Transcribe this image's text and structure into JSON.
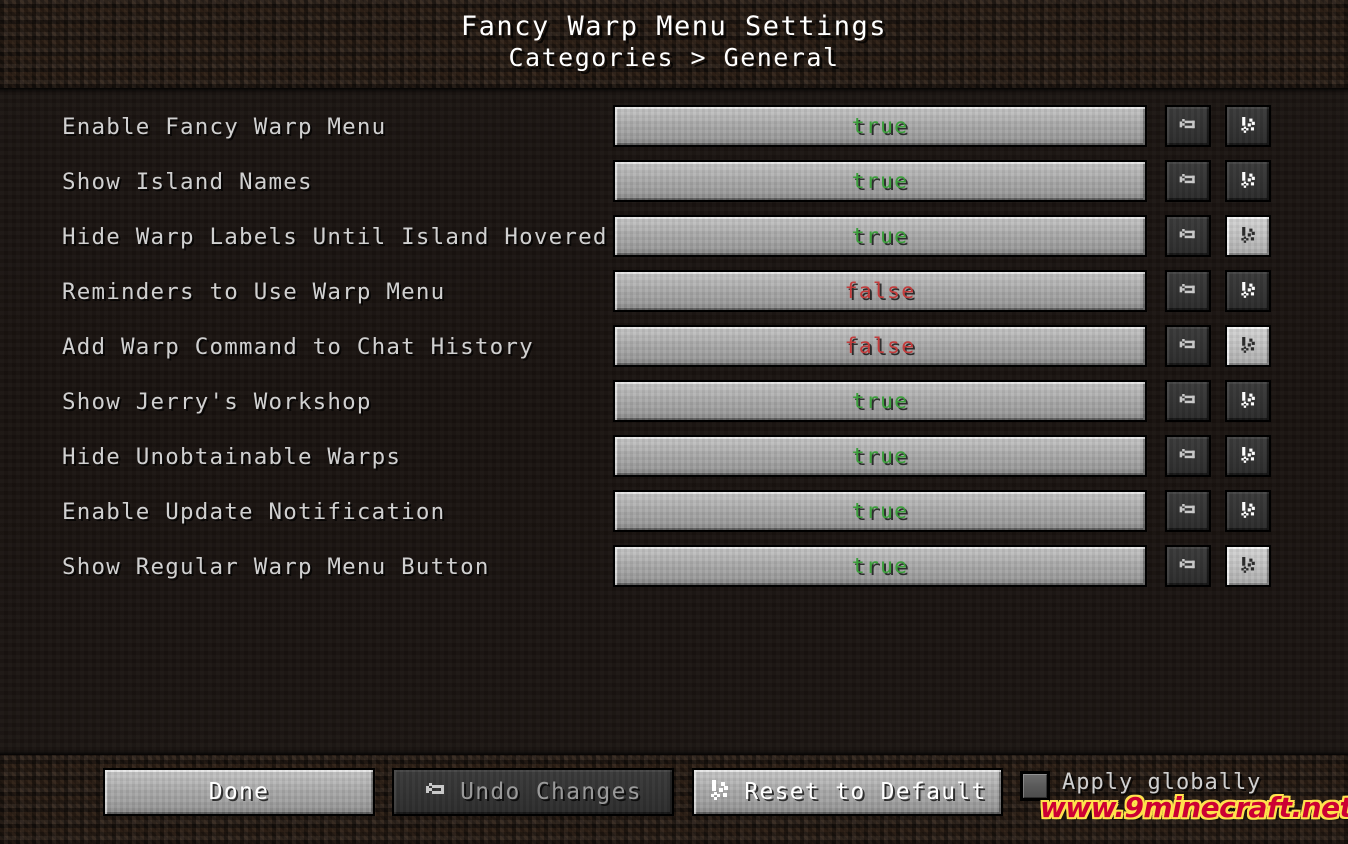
{
  "header": {
    "title": "Fancy Warp Menu Settings",
    "breadcrumb": "Categories > General"
  },
  "colors": {
    "true_value": "#3ca03c",
    "false_value": "#c43c3c",
    "label_text": "#d0d0d0",
    "button_face": "#a8a8a8",
    "dirt_background": "#4a3526",
    "watermark_fill": "#cc0033",
    "watermark_outline": "#ffe14d"
  },
  "settings": [
    {
      "label": "Enable Fancy Warp Menu",
      "value": "true",
      "undo_icon": "undo-arrow-icon",
      "reset_icon": "reset-broom-icon",
      "undo_state": "disabled",
      "reset_state": "normal"
    },
    {
      "label": "Show Island Names",
      "value": "true",
      "undo_icon": "undo-arrow-icon",
      "reset_icon": "reset-broom-icon",
      "undo_state": "disabled",
      "reset_state": "normal"
    },
    {
      "label": "Hide Warp Labels Until Island Hovered",
      "value": "true",
      "undo_icon": "undo-arrow-icon",
      "reset_icon": "reset-broom-icon",
      "undo_state": "disabled",
      "reset_state": "highlighted"
    },
    {
      "label": "Reminders to Use Warp Menu",
      "value": "false",
      "undo_icon": "undo-arrow-icon",
      "reset_icon": "reset-broom-icon",
      "undo_state": "disabled",
      "reset_state": "normal"
    },
    {
      "label": "Add Warp Command to Chat History",
      "value": "false",
      "undo_icon": "undo-arrow-icon",
      "reset_icon": "reset-broom-icon",
      "undo_state": "disabled",
      "reset_state": "highlighted"
    },
    {
      "label": "Show Jerry's Workshop",
      "value": "true",
      "undo_icon": "undo-arrow-icon",
      "reset_icon": "reset-broom-icon",
      "undo_state": "disabled",
      "reset_state": "normal"
    },
    {
      "label": "Hide Unobtainable Warps",
      "value": "true",
      "undo_icon": "undo-arrow-icon",
      "reset_icon": "reset-broom-icon",
      "undo_state": "disabled",
      "reset_state": "normal"
    },
    {
      "label": "Enable Update Notification",
      "value": "true",
      "undo_icon": "undo-arrow-icon",
      "reset_icon": "reset-broom-icon",
      "undo_state": "disabled",
      "reset_state": "normal"
    },
    {
      "label": "Show Regular Warp Menu Button",
      "value": "true",
      "undo_icon": "undo-arrow-icon",
      "reset_icon": "reset-broom-icon",
      "undo_state": "disabled",
      "reset_state": "highlighted"
    }
  ],
  "bottom_bar": {
    "done_label": "Done",
    "undo_changes_label": "Undo Changes",
    "undo_changes_icon": "undo-arrow-icon",
    "undo_changes_state": "disabled",
    "reset_default_label": "Reset to Default",
    "reset_default_icon": "reset-broom-icon",
    "apply_globally_label": "Apply globally",
    "apply_globally_checked": "false"
  },
  "watermark": {
    "text": "www.9minecraft.net"
  }
}
